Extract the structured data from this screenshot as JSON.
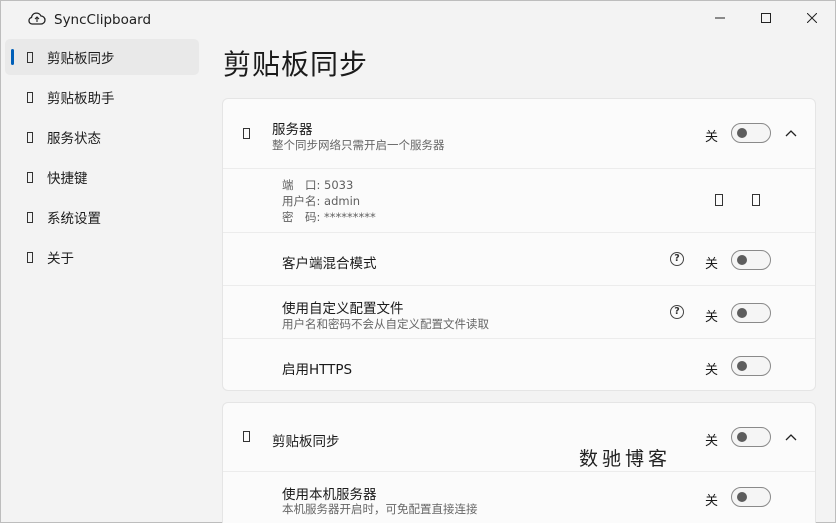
{
  "app": {
    "title": "SyncClipboard"
  },
  "sidebar": {
    "items": [
      {
        "label": "剪贴板同步",
        "active": true
      },
      {
        "label": "剪贴板助手"
      },
      {
        "label": "服务状态"
      },
      {
        "label": "快捷键"
      },
      {
        "label": "系统设置"
      },
      {
        "label": "关于"
      }
    ]
  },
  "page": {
    "title": "剪贴板同步"
  },
  "server_card": {
    "title": "服务器",
    "subtitle": "整个同步网络只需开启一个服务器",
    "toggle_label": "关",
    "info": {
      "port_label": "端　口:",
      "port_value": "5033",
      "user_label": "用户名:",
      "user_value": "admin",
      "pass_label": "密　码:",
      "pass_value": "*********"
    },
    "mixed_mode": {
      "title": "客户端混合模式",
      "toggle_label": "关"
    },
    "custom_config": {
      "title": "使用自定义配置文件",
      "subtitle": "用户名和密码不会从自定义配置文件读取",
      "toggle_label": "关"
    },
    "https": {
      "title": "启用HTTPS",
      "toggle_label": "关"
    }
  },
  "sync_card": {
    "title": "剪贴板同步",
    "toggle_label": "关",
    "local_server": {
      "title": "使用本机服务器",
      "subtitle": "本机服务器开启时，可免配置直接连接",
      "toggle_label": "关"
    }
  },
  "watermark": "数驰博客",
  "colors": {
    "accent": "#005fb8",
    "background": "#f3f3f3",
    "card": "#fbfbfb"
  }
}
